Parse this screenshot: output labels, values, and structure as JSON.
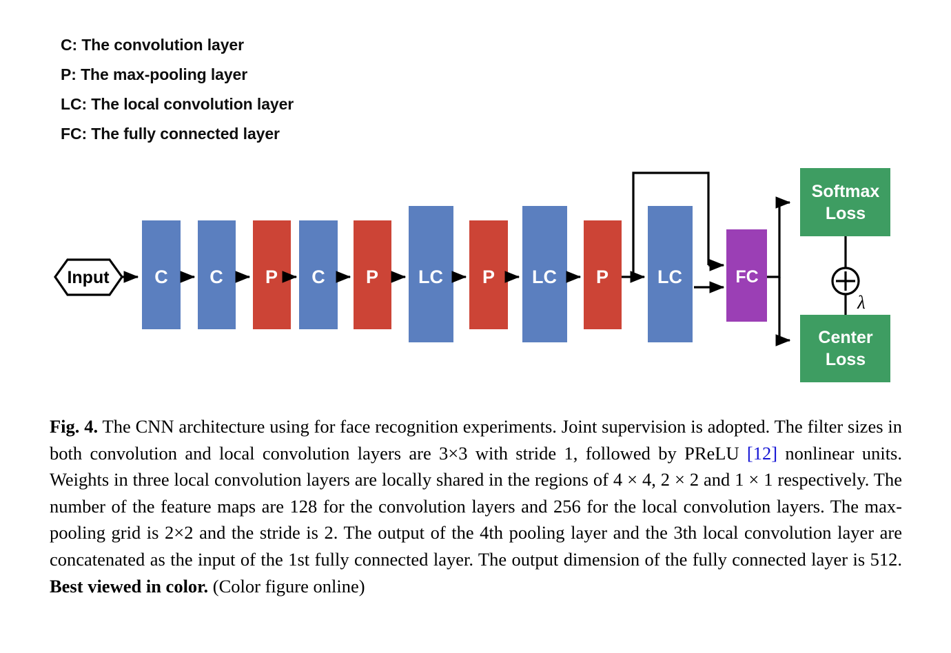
{
  "legend": {
    "lines": [
      "C: The convolution layer",
      "P: The max-pooling layer",
      "LC: The local convolution layer",
      "FC: The fully connected layer"
    ]
  },
  "colors": {
    "conv_blue": "#5b7fbf",
    "pool_red": "#cc4436",
    "fc_purple": "#9b3fb5",
    "loss_green": "#3e9d62",
    "line_black": "#000000",
    "reference_blue": "#1414d4",
    "background": "#ffffff"
  },
  "diagram": {
    "input_node": {
      "label": "Input"
    },
    "pipeline": [
      {
        "label": "C",
        "type": "conv"
      },
      {
        "label": "C",
        "type": "conv"
      },
      {
        "label": "P",
        "type": "pool"
      },
      {
        "label": "C",
        "type": "conv"
      },
      {
        "label": "P",
        "type": "pool"
      },
      {
        "label": "LC",
        "type": "localconv"
      },
      {
        "label": "P",
        "type": "pool"
      },
      {
        "label": "LC",
        "type": "localconv"
      },
      {
        "label": "P",
        "type": "pool"
      },
      {
        "label": "LC",
        "type": "localconv"
      }
    ],
    "fc_block": {
      "label": "FC",
      "type": "fc"
    },
    "loss_blocks": [
      {
        "label_line1": "Softmax",
        "label_line2": "Loss"
      },
      {
        "label_line1": "Center",
        "label_line2": "Loss"
      }
    ],
    "combiner": {
      "symbol": "+",
      "weight_label": "λ"
    }
  },
  "caption": {
    "figure_label": "Fig. 4.",
    "body_before_ref": "The CNN architecture using for face recognition experiments. Joint supervision is adopted. The filter sizes in both convolution and local convolution layers are 3×3 with stride 1, followed by PReLU ",
    "reference": "[12]",
    "body_after_ref": " nonlinear units. Weights in three local convolution layers are locally shared in the regions of 4 × 4, 2 × 2 and 1 × 1 respectively. The number of the feature maps are 128 for the convolution layers and 256 for the local convolution layers. The max-pooling grid is 2×2 and the stride is 2. The output of the 4th pooling layer and the 3th local convolution layer are concatenated as the input of the 1st fully connected layer. The output dimension of the fully connected layer is 512. ",
    "bold_tail": "Best viewed in color.",
    "trailing": " (Color figure online)"
  }
}
